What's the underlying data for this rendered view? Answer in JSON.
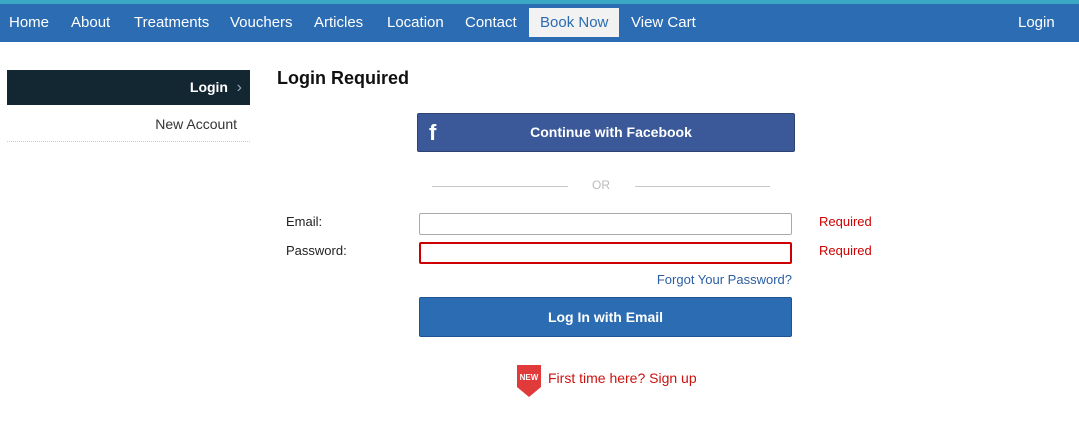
{
  "nav": {
    "items": [
      {
        "label": "Home"
      },
      {
        "label": "About"
      },
      {
        "label": "Treatments"
      },
      {
        "label": "Vouchers"
      },
      {
        "label": "Articles"
      },
      {
        "label": "Location"
      },
      {
        "label": "Contact"
      },
      {
        "label": "Book Now"
      },
      {
        "label": "View Cart"
      }
    ],
    "login_label": "Login"
  },
  "sidebar": {
    "login_label": "Login",
    "new_account_label": "New Account"
  },
  "main": {
    "title": "Login Required",
    "facebook_label": "Continue with Facebook",
    "facebook_icon": "facebook-icon",
    "or_label": "OR",
    "email": {
      "label": "Email:",
      "value": "",
      "required_text": "Required"
    },
    "password": {
      "label": "Password:",
      "value": "",
      "required_text": "Required"
    },
    "forgot_label": "Forgot Your Password?",
    "email_login_label": "Log In with Email",
    "new_badge": "NEW",
    "signup_label": "First time here? Sign up"
  },
  "colors": {
    "nav_bg": "#2b6cb3",
    "sidebar_active_bg": "#132733",
    "facebook_blue": "#3b5998",
    "primary_button": "#2b6cb3",
    "error_red": "#cc0000"
  }
}
